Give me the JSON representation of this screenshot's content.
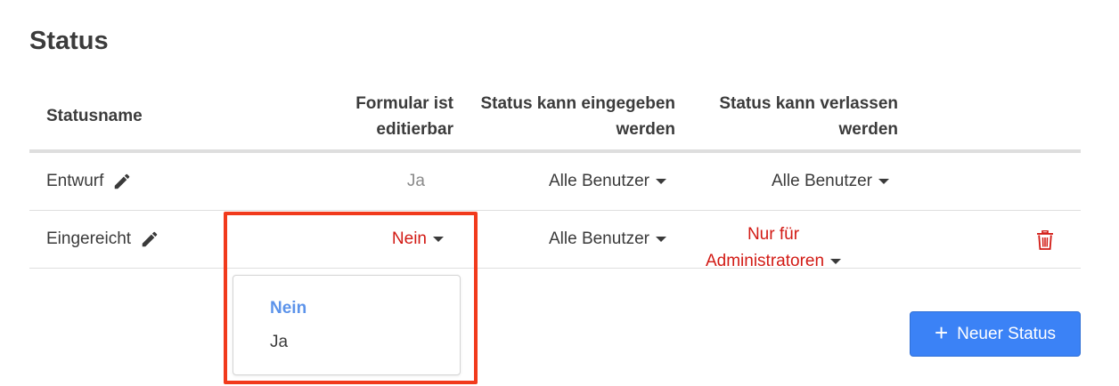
{
  "page": {
    "title": "Status"
  },
  "columns": {
    "name": "Statusname",
    "form_editable_line1": "Formular ist",
    "form_editable_line2": "editierbar",
    "can_enter_line1": "Status kann eingegeben",
    "can_enter_line2": "werden",
    "can_leave_line1": "Status kann verlassen",
    "can_leave_line2": "werden"
  },
  "rows": [
    {
      "name": "Entwurf",
      "form_editable": "Ja",
      "can_enter": "Alle Benutzer",
      "can_leave": "Alle Benutzer"
    },
    {
      "name": "Eingereicht",
      "form_editable": "Nein",
      "can_enter": "Alle Benutzer",
      "can_leave_line1": "Nur für",
      "can_leave_line2": "Administratoren"
    }
  ],
  "dropdown": {
    "options": [
      "Nein",
      "Ja"
    ],
    "selected": "Nein"
  },
  "actions": {
    "new_status_plus": "+",
    "new_status_label": "Neuer Status"
  },
  "colors": {
    "accent": "#3b82f6",
    "danger": "#d21a14",
    "highlight": "#f13a1c",
    "selected_option": "#5c93ea"
  },
  "icons": {
    "edit": "pencil-icon",
    "delete": "trash-icon",
    "caret": "caret-down-icon",
    "plus": "plus-icon"
  }
}
